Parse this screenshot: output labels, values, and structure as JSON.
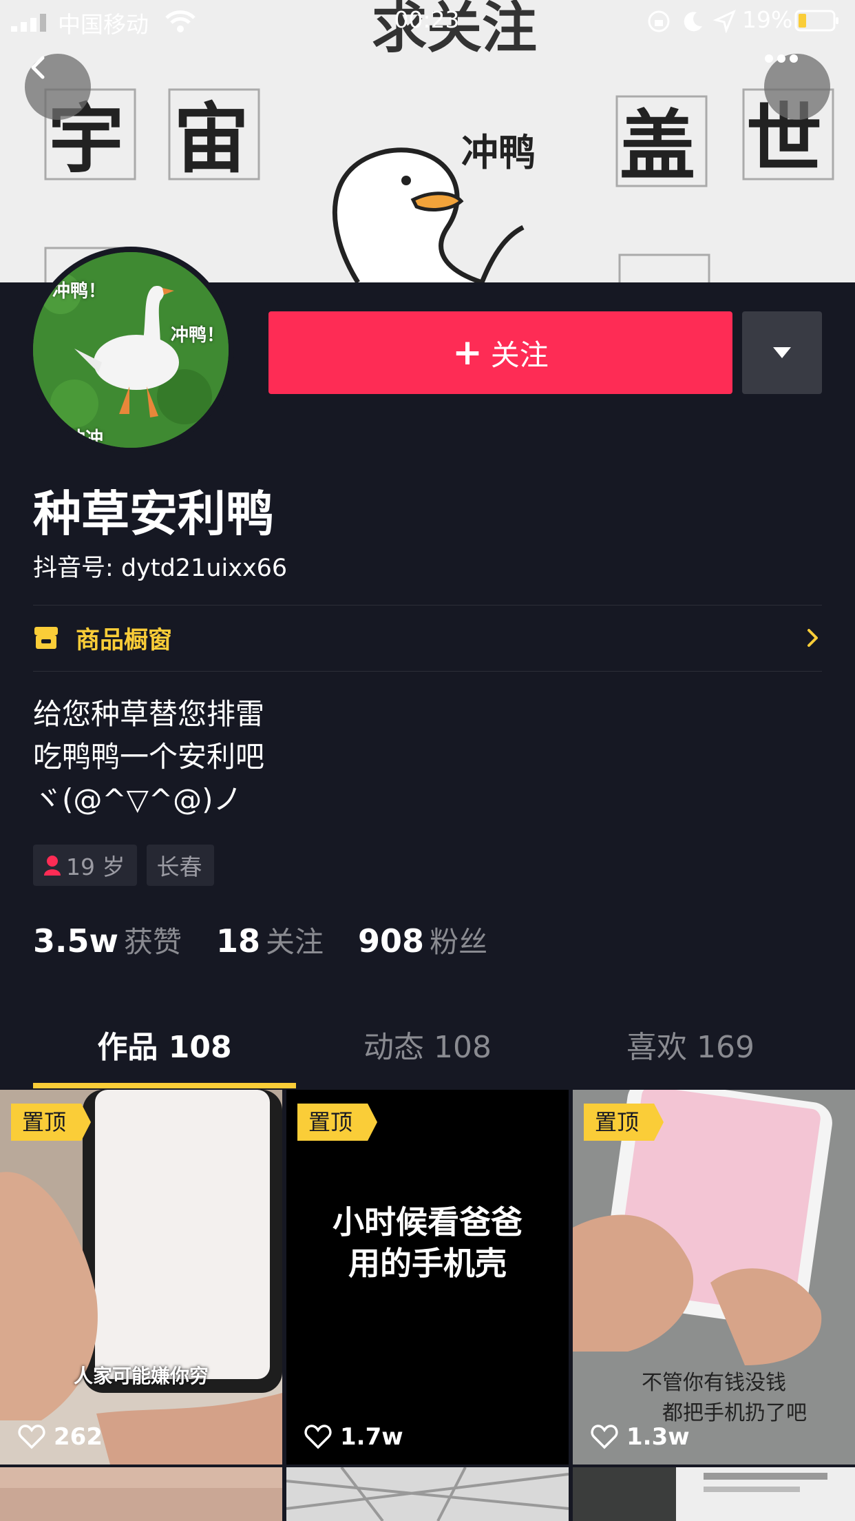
{
  "status_bar": {
    "carrier": "中国移动",
    "time": "00:23",
    "battery_percent": "19%"
  },
  "banner": {
    "texts": [
      "求关注",
      "宇",
      "宙",
      "盖",
      "世",
      "冲鸭"
    ]
  },
  "avatar": {
    "captions": [
      "冲鸭！",
      "冲鸭！",
      "冲冲"
    ]
  },
  "actions": {
    "follow_label": "关注"
  },
  "profile": {
    "nickname": "种草安利鸭",
    "douyin_id": "抖音号: dytd21uixx66",
    "shop_label": "商品橱窗",
    "bio": [
      "给您种草替您排雷",
      "吃鸭鸭一个安利吧",
      "ヾ(@^▽^@)ノ"
    ],
    "tags": {
      "age": "19 岁",
      "city": "长春"
    }
  },
  "stats": [
    {
      "num": "3.5w",
      "label": "获赞"
    },
    {
      "num": "18",
      "label": "关注"
    },
    {
      "num": "908",
      "label": "粉丝"
    }
  ],
  "tabs": [
    {
      "label": "作品 108",
      "active": true
    },
    {
      "label": "动态 108",
      "active": false
    },
    {
      "label": "喜欢 169",
      "active": false
    }
  ],
  "videos": [
    {
      "pinned": "置顶",
      "caption": "人家可能嫌你穷",
      "likes": "262"
    },
    {
      "pinned": "置顶",
      "caption_line1": "小时候看爸爸",
      "caption_line2": "用的手机壳",
      "likes": "1.7w"
    },
    {
      "pinned": "置顶",
      "caption_line1": "不管你有钱没钱",
      "caption_line2": "都把手机扔了吧",
      "likes": "1.3w"
    }
  ],
  "colors": {
    "background": "#161823",
    "accent_red": "#fe2c55",
    "accent_yellow": "#facd38"
  }
}
